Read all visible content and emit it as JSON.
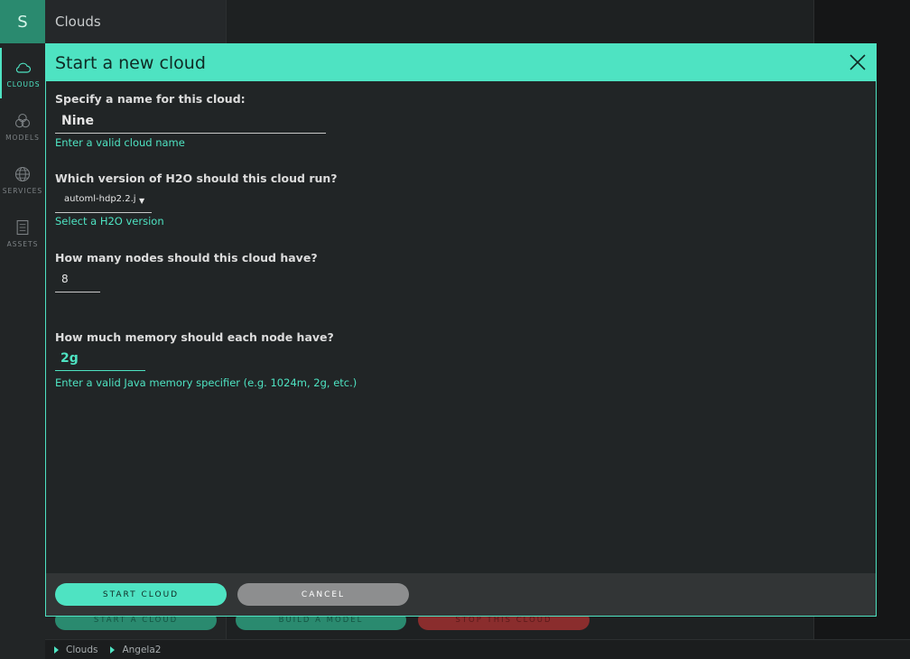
{
  "rail": {
    "logo": "S",
    "items": [
      {
        "label": "CLOUDS",
        "icon": "cloud-icon"
      },
      {
        "label": "MODELS",
        "icon": "models-icon"
      },
      {
        "label": "SERVICES",
        "icon": "globe-icon"
      },
      {
        "label": "ASSETS",
        "icon": "assets-icon"
      }
    ],
    "accent": "#4ee3c2"
  },
  "topbar": {
    "title": "Clouds"
  },
  "background_buttons": {
    "start": "START A CLOUD",
    "build": "BUILD A MODEL",
    "stop": "STOP THIS CLOUD"
  },
  "breadcrumb": [
    "Clouds",
    "Angela2"
  ],
  "modal": {
    "title": "Start a new cloud",
    "name_question": "Specify a name for this cloud:",
    "name_value": "Nine",
    "name_hint": "Enter a valid cloud name",
    "version_question": "Which version of H2O should this cloud run?",
    "version_value": "automl-hdp2.2.j",
    "version_hint": "Select a H2O version",
    "nodes_question": "How many nodes should this cloud have?",
    "nodes_value": "8",
    "memory_question": "How much memory should each node have?",
    "memory_value": "2g",
    "memory_hint": "Enter a valid Java memory specifier (e.g. 1024m, 2g, etc.)",
    "start_label": "START CLOUD",
    "cancel_label": "CANCEL"
  }
}
